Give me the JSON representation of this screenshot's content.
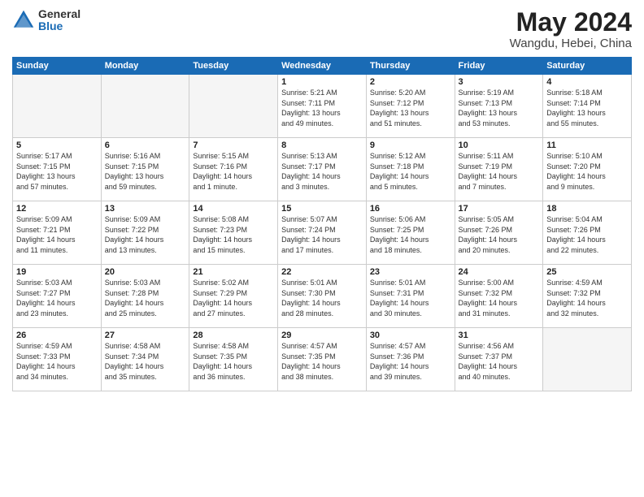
{
  "header": {
    "logo_general": "General",
    "logo_blue": "Blue",
    "title": "May 2024",
    "location": "Wangdu, Hebei, China"
  },
  "days_of_week": [
    "Sunday",
    "Monday",
    "Tuesday",
    "Wednesday",
    "Thursday",
    "Friday",
    "Saturday"
  ],
  "weeks": [
    [
      {
        "day": "",
        "info": ""
      },
      {
        "day": "",
        "info": ""
      },
      {
        "day": "",
        "info": ""
      },
      {
        "day": "1",
        "info": "Sunrise: 5:21 AM\nSunset: 7:11 PM\nDaylight: 13 hours\nand 49 minutes."
      },
      {
        "day": "2",
        "info": "Sunrise: 5:20 AM\nSunset: 7:12 PM\nDaylight: 13 hours\nand 51 minutes."
      },
      {
        "day": "3",
        "info": "Sunrise: 5:19 AM\nSunset: 7:13 PM\nDaylight: 13 hours\nand 53 minutes."
      },
      {
        "day": "4",
        "info": "Sunrise: 5:18 AM\nSunset: 7:14 PM\nDaylight: 13 hours\nand 55 minutes."
      }
    ],
    [
      {
        "day": "5",
        "info": "Sunrise: 5:17 AM\nSunset: 7:15 PM\nDaylight: 13 hours\nand 57 minutes."
      },
      {
        "day": "6",
        "info": "Sunrise: 5:16 AM\nSunset: 7:15 PM\nDaylight: 13 hours\nand 59 minutes."
      },
      {
        "day": "7",
        "info": "Sunrise: 5:15 AM\nSunset: 7:16 PM\nDaylight: 14 hours\nand 1 minute."
      },
      {
        "day": "8",
        "info": "Sunrise: 5:13 AM\nSunset: 7:17 PM\nDaylight: 14 hours\nand 3 minutes."
      },
      {
        "day": "9",
        "info": "Sunrise: 5:12 AM\nSunset: 7:18 PM\nDaylight: 14 hours\nand 5 minutes."
      },
      {
        "day": "10",
        "info": "Sunrise: 5:11 AM\nSunset: 7:19 PM\nDaylight: 14 hours\nand 7 minutes."
      },
      {
        "day": "11",
        "info": "Sunrise: 5:10 AM\nSunset: 7:20 PM\nDaylight: 14 hours\nand 9 minutes."
      }
    ],
    [
      {
        "day": "12",
        "info": "Sunrise: 5:09 AM\nSunset: 7:21 PM\nDaylight: 14 hours\nand 11 minutes."
      },
      {
        "day": "13",
        "info": "Sunrise: 5:09 AM\nSunset: 7:22 PM\nDaylight: 14 hours\nand 13 minutes."
      },
      {
        "day": "14",
        "info": "Sunrise: 5:08 AM\nSunset: 7:23 PM\nDaylight: 14 hours\nand 15 minutes."
      },
      {
        "day": "15",
        "info": "Sunrise: 5:07 AM\nSunset: 7:24 PM\nDaylight: 14 hours\nand 17 minutes."
      },
      {
        "day": "16",
        "info": "Sunrise: 5:06 AM\nSunset: 7:25 PM\nDaylight: 14 hours\nand 18 minutes."
      },
      {
        "day": "17",
        "info": "Sunrise: 5:05 AM\nSunset: 7:26 PM\nDaylight: 14 hours\nand 20 minutes."
      },
      {
        "day": "18",
        "info": "Sunrise: 5:04 AM\nSunset: 7:26 PM\nDaylight: 14 hours\nand 22 minutes."
      }
    ],
    [
      {
        "day": "19",
        "info": "Sunrise: 5:03 AM\nSunset: 7:27 PM\nDaylight: 14 hours\nand 23 minutes."
      },
      {
        "day": "20",
        "info": "Sunrise: 5:03 AM\nSunset: 7:28 PM\nDaylight: 14 hours\nand 25 minutes."
      },
      {
        "day": "21",
        "info": "Sunrise: 5:02 AM\nSunset: 7:29 PM\nDaylight: 14 hours\nand 27 minutes."
      },
      {
        "day": "22",
        "info": "Sunrise: 5:01 AM\nSunset: 7:30 PM\nDaylight: 14 hours\nand 28 minutes."
      },
      {
        "day": "23",
        "info": "Sunrise: 5:01 AM\nSunset: 7:31 PM\nDaylight: 14 hours\nand 30 minutes."
      },
      {
        "day": "24",
        "info": "Sunrise: 5:00 AM\nSunset: 7:32 PM\nDaylight: 14 hours\nand 31 minutes."
      },
      {
        "day": "25",
        "info": "Sunrise: 4:59 AM\nSunset: 7:32 PM\nDaylight: 14 hours\nand 32 minutes."
      }
    ],
    [
      {
        "day": "26",
        "info": "Sunrise: 4:59 AM\nSunset: 7:33 PM\nDaylight: 14 hours\nand 34 minutes."
      },
      {
        "day": "27",
        "info": "Sunrise: 4:58 AM\nSunset: 7:34 PM\nDaylight: 14 hours\nand 35 minutes."
      },
      {
        "day": "28",
        "info": "Sunrise: 4:58 AM\nSunset: 7:35 PM\nDaylight: 14 hours\nand 36 minutes."
      },
      {
        "day": "29",
        "info": "Sunrise: 4:57 AM\nSunset: 7:35 PM\nDaylight: 14 hours\nand 38 minutes."
      },
      {
        "day": "30",
        "info": "Sunrise: 4:57 AM\nSunset: 7:36 PM\nDaylight: 14 hours\nand 39 minutes."
      },
      {
        "day": "31",
        "info": "Sunrise: 4:56 AM\nSunset: 7:37 PM\nDaylight: 14 hours\nand 40 minutes."
      },
      {
        "day": "",
        "info": ""
      }
    ]
  ]
}
